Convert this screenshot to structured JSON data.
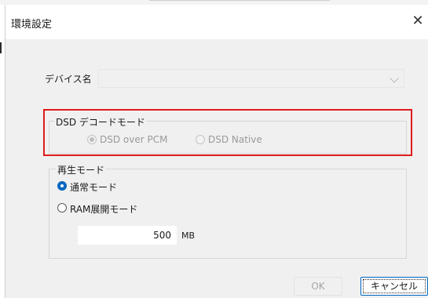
{
  "window": {
    "title": "環境設定",
    "close_glyph": "✕"
  },
  "device": {
    "label": "デバイス名",
    "value": ""
  },
  "dsd_decode": {
    "legend": "DSD デコードモード",
    "options": [
      {
        "label": "DSD over PCM",
        "checked": true,
        "enabled": false
      },
      {
        "label": "DSD Native",
        "checked": false,
        "enabled": false
      }
    ]
  },
  "playback": {
    "legend": "再生モード",
    "options": [
      {
        "label": "通常モード",
        "checked": true,
        "enabled": true
      },
      {
        "label": "RAM展開モード",
        "checked": false,
        "enabled": true
      }
    ],
    "ram_size": "500",
    "ram_unit": "MB"
  },
  "buttons": {
    "ok": "OK",
    "cancel": "キャンセル"
  },
  "colors": {
    "accent": "#0067c0",
    "highlight_frame": "#e01b1b"
  },
  "icons": {
    "close": "close-icon",
    "dropdown": "chevron-down-icon"
  }
}
